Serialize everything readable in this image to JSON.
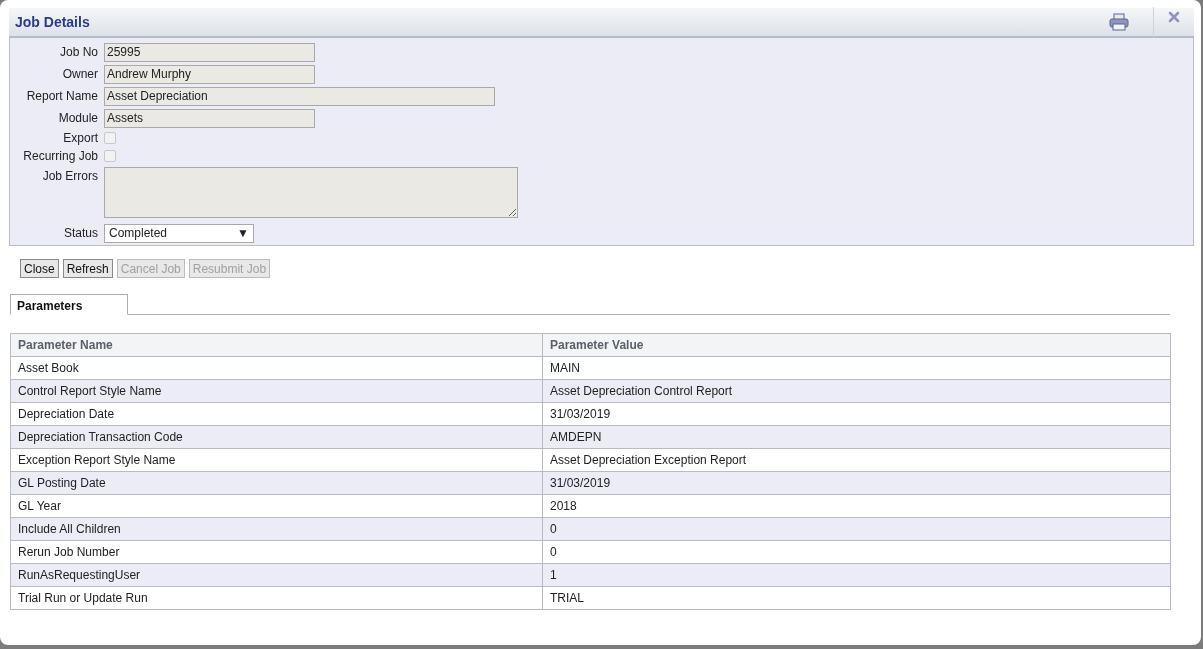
{
  "window": {
    "title": "Job Details"
  },
  "form": {
    "fields": [
      {
        "kind": "text",
        "label": "Job No",
        "value": "25995"
      },
      {
        "kind": "text",
        "label": "Owner",
        "value": "Andrew Murphy"
      },
      {
        "kind": "widetext",
        "label": "Report Name",
        "value": "Asset Depreciation"
      },
      {
        "kind": "text",
        "label": "Module",
        "value": "Assets"
      },
      {
        "kind": "checkbox",
        "label": "Export",
        "checked": false
      },
      {
        "kind": "checkbox",
        "label": "Recurring Job",
        "checked": false
      },
      {
        "kind": "textarea",
        "label": "Job Errors"
      },
      {
        "kind": "select",
        "label": "Status",
        "value": "Completed",
        "caret": "▼"
      }
    ]
  },
  "buttons": [
    {
      "label": "Close",
      "disabled": false
    },
    {
      "label": "Refresh",
      "disabled": false
    },
    {
      "label": "Cancel Job",
      "disabled": true
    },
    {
      "label": "Resubmit Job",
      "disabled": true
    }
  ],
  "tabs": [
    {
      "label": "Parameters",
      "selected": true
    }
  ],
  "table": {
    "columns": [
      "Parameter Name",
      "Parameter Value"
    ],
    "rows": [
      [
        "Asset Book",
        "MAIN"
      ],
      [
        "Control Report Style Name",
        "Asset Depreciation Control Report"
      ],
      [
        "Depreciation Date",
        "31/03/2019"
      ],
      [
        "Depreciation Transaction Code",
        "AMDEPN"
      ],
      [
        "Exception Report Style Name",
        "Asset Depreciation Exception Report"
      ],
      [
        "GL Posting Date",
        "31/03/2019"
      ],
      [
        "GL Year",
        "2018"
      ],
      [
        "Include All Children",
        "0"
      ],
      [
        "Rerun Job Number",
        "0"
      ],
      [
        "RunAsRequestingUser",
        "1"
      ],
      [
        "Trial Run or Update Run",
        "TRIAL"
      ]
    ]
  }
}
